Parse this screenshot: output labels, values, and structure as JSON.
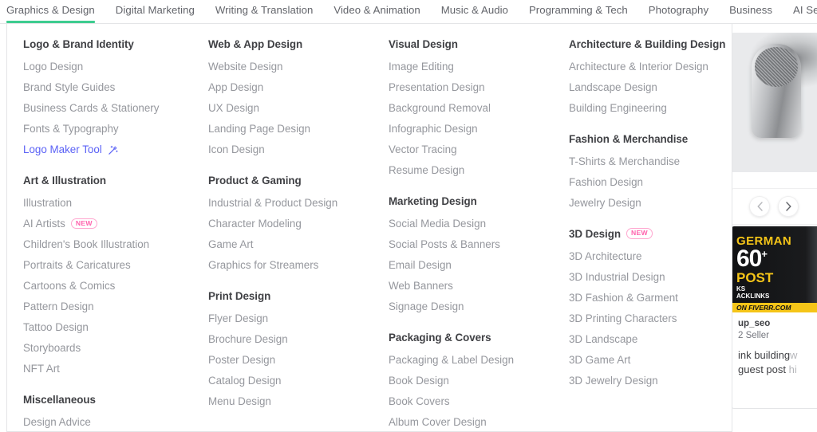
{
  "theme": {
    "accent_green": "#3ecc8f",
    "link_blue": "#5b62f6",
    "badge_pink": "#ff62ad",
    "text_heading": "#404145",
    "text_link": "#95979d",
    "nav_text": "#62646a"
  },
  "nav": {
    "items": [
      {
        "label": "Graphics & Design",
        "active": true
      },
      {
        "label": "Digital Marketing",
        "active": false
      },
      {
        "label": "Writing & Translation",
        "active": false
      },
      {
        "label": "Video & Animation",
        "active": false
      },
      {
        "label": "Music & Audio",
        "active": false
      },
      {
        "label": "Programming & Tech",
        "active": false
      },
      {
        "label": "Photography",
        "active": false
      },
      {
        "label": "Business",
        "active": false
      },
      {
        "label": "AI Services",
        "active": false
      }
    ]
  },
  "mega_menu": {
    "columns": [
      {
        "groups": [
          {
            "title": "Logo & Brand Identity",
            "items": [
              {
                "label": "Logo Design"
              },
              {
                "label": "Brand Style Guides"
              },
              {
                "label": "Business Cards & Stationery"
              },
              {
                "label": "Fonts & Typography"
              },
              {
                "label": "Logo Maker Tool",
                "style": "tool",
                "icon": "magic-wand-icon"
              }
            ]
          },
          {
            "title": "Art & Illustration",
            "items": [
              {
                "label": "Illustration"
              },
              {
                "label": "AI Artists",
                "badge": "NEW"
              },
              {
                "label": "Children's Book Illustration"
              },
              {
                "label": "Portraits & Caricatures"
              },
              {
                "label": "Cartoons & Comics"
              },
              {
                "label": "Pattern Design"
              },
              {
                "label": "Tattoo Design"
              },
              {
                "label": "Storyboards"
              },
              {
                "label": "NFT Art"
              }
            ]
          },
          {
            "title": "Miscellaneous",
            "items": [
              {
                "label": "Design Advice"
              }
            ]
          }
        ]
      },
      {
        "groups": [
          {
            "title": "Web & App Design",
            "items": [
              {
                "label": "Website Design"
              },
              {
                "label": "App Design"
              },
              {
                "label": "UX Design"
              },
              {
                "label": "Landing Page Design"
              },
              {
                "label": "Icon Design"
              }
            ]
          },
          {
            "title": "Product & Gaming",
            "items": [
              {
                "label": "Industrial & Product Design"
              },
              {
                "label": "Character Modeling"
              },
              {
                "label": "Game Art"
              },
              {
                "label": "Graphics for Streamers"
              }
            ]
          },
          {
            "title": "Print Design",
            "items": [
              {
                "label": "Flyer Design"
              },
              {
                "label": "Brochure Design"
              },
              {
                "label": "Poster Design"
              },
              {
                "label": "Catalog Design"
              },
              {
                "label": "Menu Design"
              }
            ]
          }
        ]
      },
      {
        "groups": [
          {
            "title": "Visual Design",
            "items": [
              {
                "label": "Image Editing"
              },
              {
                "label": "Presentation Design"
              },
              {
                "label": "Background Removal"
              },
              {
                "label": "Infographic Design"
              },
              {
                "label": "Vector Tracing"
              },
              {
                "label": "Resume Design"
              }
            ]
          },
          {
            "title": "Marketing Design",
            "items": [
              {
                "label": "Social Media Design"
              },
              {
                "label": "Social Posts & Banners"
              },
              {
                "label": "Email Design"
              },
              {
                "label": "Web Banners"
              },
              {
                "label": "Signage Design"
              }
            ]
          },
          {
            "title": "Packaging & Covers",
            "items": [
              {
                "label": "Packaging & Label Design"
              },
              {
                "label": "Book Design"
              },
              {
                "label": "Book Covers"
              },
              {
                "label": "Album Cover Design"
              }
            ]
          }
        ]
      },
      {
        "groups": [
          {
            "title": "Architecture & Building Design",
            "items": [
              {
                "label": "Architecture & Interior Design"
              },
              {
                "label": "Landscape Design"
              },
              {
                "label": "Building Engineering"
              }
            ]
          },
          {
            "title": "Fashion & Merchandise",
            "items": [
              {
                "label": "T-Shirts & Merchandise"
              },
              {
                "label": "Fashion Design"
              },
              {
                "label": "Jewelry Design"
              }
            ]
          },
          {
            "title": "3D Design",
            "badge": "NEW",
            "items": [
              {
                "label": "3D Architecture"
              },
              {
                "label": "3D Industrial Design"
              },
              {
                "label": "3D Fashion & Garment"
              },
              {
                "label": "3D Printing Characters"
              },
              {
                "label": "3D Landscape"
              },
              {
                "label": "3D Game Art"
              },
              {
                "label": "3D Jewelry Design"
              }
            ]
          }
        ]
      }
    ]
  },
  "background_rail": {
    "microphone_card": {
      "image_alt": "studio-microphone-photo"
    },
    "carousel": {
      "prev_icon": "chevron-left-icon",
      "next_icon": "chevron-right-icon"
    },
    "ad_card": {
      "banner_line1": "GERMAN",
      "banner_line2": "60",
      "banner_sup": "+",
      "banner_line3": "POST",
      "banner_line4": "KS",
      "banner_line5": "ACKLINKS",
      "banner_line6": "ON FIVERR.COM",
      "seller": "up_seo",
      "level": "2 Seller",
      "title_line1": "ink building",
      "title_line1_dim": "w",
      "title_line2": "guest post",
      "title_line2_dim": " hi"
    }
  }
}
